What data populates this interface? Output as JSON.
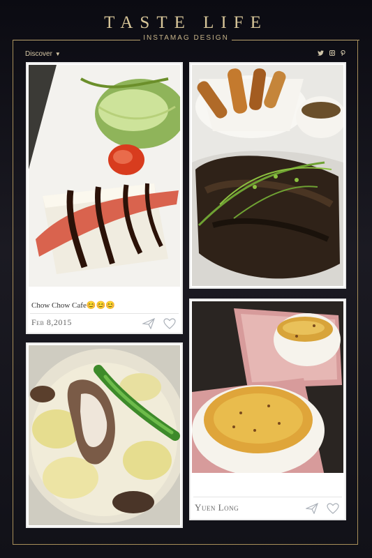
{
  "header": {
    "title": "TASTE LIFE",
    "subtitle": "INSTAMAG DESIGN"
  },
  "nav": {
    "discover_label": "Discover",
    "discover_caret": "▼",
    "social": [
      {
        "name": "twitter-icon",
        "glyph": "🐦"
      },
      {
        "name": "instagram-icon",
        "glyph": "◙"
      },
      {
        "name": "pinterest-icon",
        "glyph": "℗"
      }
    ]
  },
  "cards": [
    {
      "caption": "Chow Chow Cafe😊😊😊",
      "date": "Feb 8,2015",
      "photo_desc": "tofu with bacon and salad"
    },
    {
      "photo_desc": "steak with wedges"
    },
    {
      "photo_desc": "creamy ravioli"
    },
    {
      "caption": "Yuen Long",
      "photo_desc": "creme brulee"
    }
  ],
  "colors": {
    "accent_gold": "#d9c79a",
    "frame_gold": "#a88f5a",
    "background": "#111118"
  }
}
